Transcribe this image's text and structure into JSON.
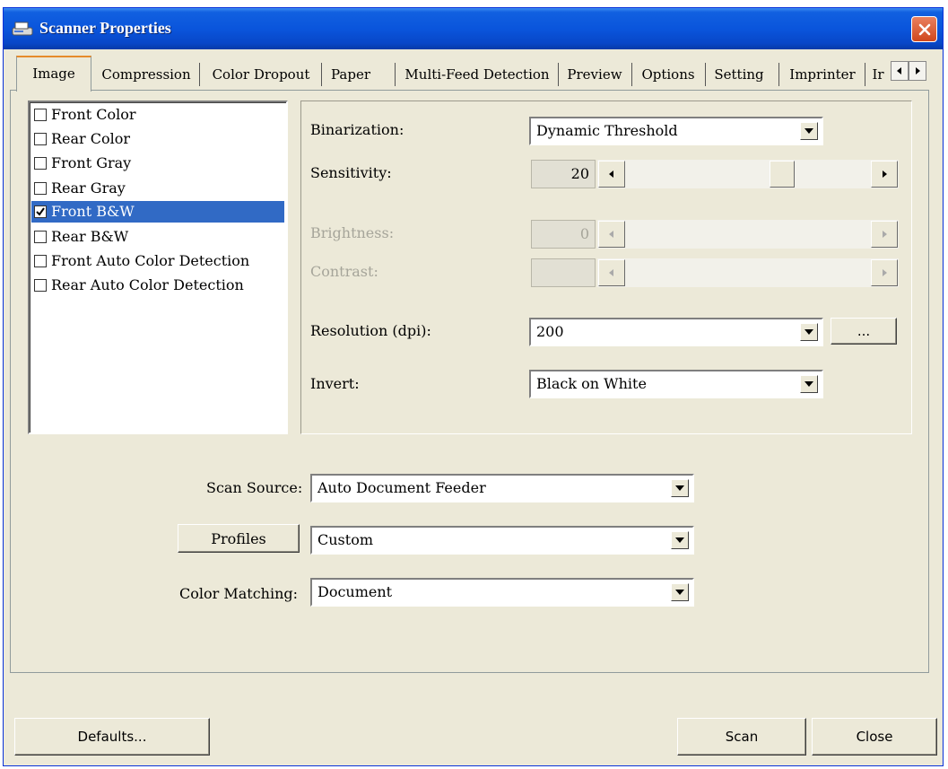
{
  "window": {
    "title": "Scanner Properties"
  },
  "tabs": [
    {
      "label": "Image"
    },
    {
      "label": "Compression"
    },
    {
      "label": "Color Dropout"
    },
    {
      "label": "Paper"
    },
    {
      "label": "Multi-Feed Detection"
    },
    {
      "label": "Preview"
    },
    {
      "label": "Options"
    },
    {
      "label": "Setting"
    },
    {
      "label": "Imprinter"
    },
    {
      "label": "Ir"
    }
  ],
  "image_list": [
    {
      "label": "Front Color",
      "checked": false
    },
    {
      "label": "Rear Color",
      "checked": false
    },
    {
      "label": "Front Gray",
      "checked": false
    },
    {
      "label": "Rear Gray",
      "checked": false
    },
    {
      "label": "Front B&W",
      "checked": true,
      "selected": true
    },
    {
      "label": "Rear B&W",
      "checked": false
    },
    {
      "label": "Front Auto Color Detection",
      "checked": false
    },
    {
      "label": "Rear Auto Color Detection",
      "checked": false
    }
  ],
  "settings": {
    "binarization": {
      "label": "Binarization:",
      "value": "Dynamic Threshold"
    },
    "sensitivity": {
      "label": "Sensitivity:",
      "value": "20"
    },
    "brightness": {
      "label": "Brightness:",
      "value": "0"
    },
    "contrast": {
      "label": "Contrast:",
      "value": ""
    },
    "resolution": {
      "label": "Resolution (dpi):",
      "value": "200",
      "more_button": "..."
    },
    "invert": {
      "label": "Invert:",
      "value": "Black on White"
    }
  },
  "bottom": {
    "scan_source": {
      "label": "Scan Source:",
      "value": "Auto Document Feeder"
    },
    "profiles": {
      "button": "Profiles",
      "value": "Custom"
    },
    "color_matching": {
      "label": "Color Matching:",
      "value": "Document"
    }
  },
  "buttons": {
    "defaults": "Defaults...",
    "scan": "Scan",
    "close": "Close"
  },
  "colors": {
    "titlebar": "#0a55dc",
    "selection": "#316ac5",
    "dialog_bg": "#ece9d8",
    "close_button": "#d0471c"
  }
}
